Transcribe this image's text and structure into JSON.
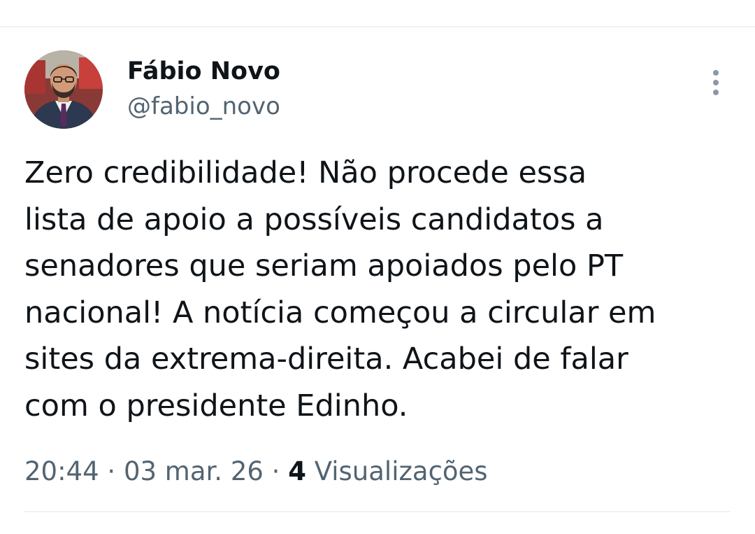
{
  "author": {
    "display_name": "Fábio Novo",
    "handle": "@fabio_novo",
    "avatar_icon": "profile-photo"
  },
  "more_icon": "more-vertical-icon",
  "tweet": {
    "lines": [
      "Zero credibilidade! Não procede essa",
      "lista de apoio a possíveis candidatos a",
      "senadores que seriam apoiados pelo PT",
      "nacional! A notícia começou a circular em",
      "sites da extrema-direita. Acabei de falar",
      "com o presidente Edinho."
    ]
  },
  "meta": {
    "time": "20:44",
    "separator": " · ",
    "date": "03 mar. 26",
    "views_count": "4",
    "views_label": "Visualizações"
  },
  "colors": {
    "primary_text": "#0f1419",
    "secondary_text": "#536471",
    "divider": "#eff3f4"
  }
}
